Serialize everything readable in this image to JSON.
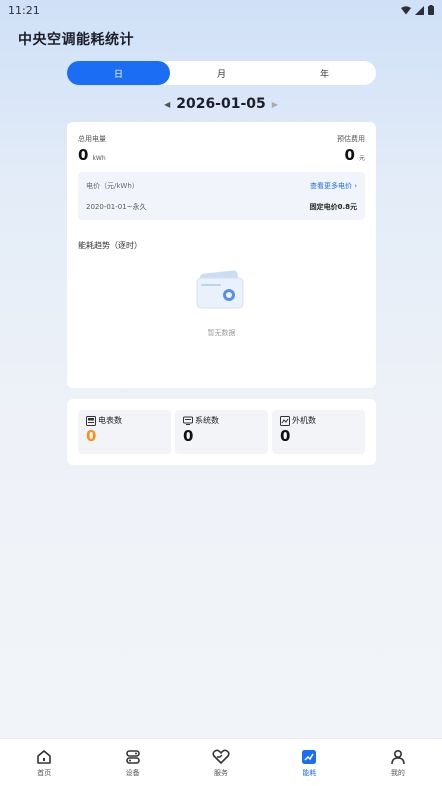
{
  "status_bar": {
    "time": "11:21"
  },
  "app": {
    "title": "中央空调能耗统计"
  },
  "period_tabs": [
    {
      "label": "日",
      "active": true
    },
    {
      "label": "月",
      "active": false
    },
    {
      "label": "年",
      "active": false
    }
  ],
  "date": {
    "value": "2026-01-05"
  },
  "summary": {
    "total_power_label": "总用电量",
    "total_power_value": "0",
    "total_power_unit": "kWh",
    "estimated_cost_label": "预估费用",
    "estimated_cost_value": "0",
    "estimated_cost_unit": "元"
  },
  "price": {
    "label": "电价（元/kWh）",
    "link": "查看更多电价",
    "range": "2020-01-01~永久",
    "fixed": "固定电价0.8元"
  },
  "trend": {
    "title": "能耗趋势（逐时）",
    "empty_text": "暂无数据"
  },
  "counts": [
    {
      "label": "电表数",
      "value": "0",
      "icon": "meter-icon",
      "color": "#f5921e"
    },
    {
      "label": "系统数",
      "value": "0",
      "icon": "monitor-icon",
      "color": "#111111"
    },
    {
      "label": "外机数",
      "value": "0",
      "icon": "outdoor-unit-icon",
      "color": "#111111"
    }
  ],
  "tabbar": [
    {
      "label": "首页",
      "icon": "home-icon",
      "active": false
    },
    {
      "label": "设备",
      "icon": "device-icon",
      "active": false
    },
    {
      "label": "服务",
      "icon": "service-icon",
      "active": false
    },
    {
      "label": "能耗",
      "icon": "energy-chart-icon",
      "active": true
    },
    {
      "label": "我的",
      "icon": "user-icon",
      "active": false
    }
  ],
  "colors": {
    "accent": "#1b6ef3",
    "highlight": "#f5921e"
  }
}
